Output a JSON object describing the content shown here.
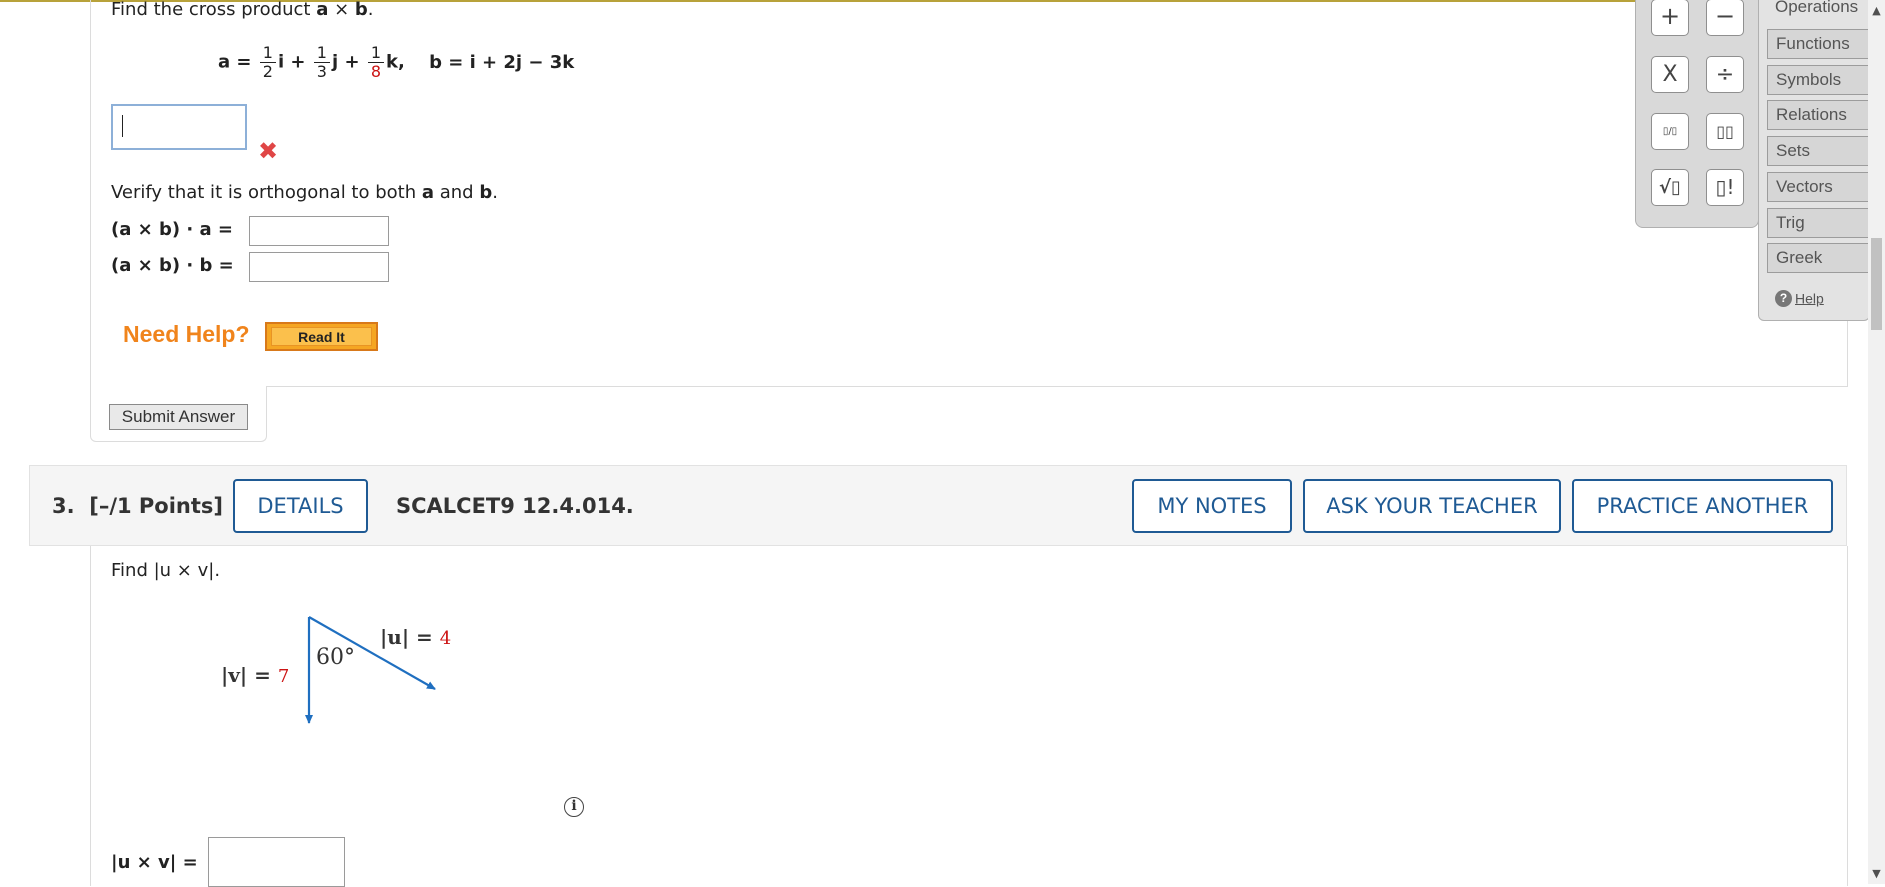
{
  "question2": {
    "prompt_pre": "Find the cross product ",
    "prompt_a": "a",
    "prompt_times": " × ",
    "prompt_b": "b",
    "prompt_end": ".",
    "vec_a_label": "a =",
    "frac_numerator": "1",
    "frac1_den": "2",
    "frac2_den": "3",
    "frac3_den": "8",
    "unit_i": "i",
    "unit_j": "j",
    "unit_k": "k,",
    "plus": "+",
    "vec_b_expr": "b = i + 2j − 3k",
    "wrong_mark": "✖",
    "verify_pre": "Verify that it is orthogonal to both ",
    "verify_a": "a",
    "verify_and": " and ",
    "verify_b": "b",
    "verify_end": ".",
    "dot_a_label": "(a × b) · a =",
    "dot_b_label": "(a × b) · b =",
    "need_help": "Need Help?",
    "read_it": "Read It",
    "submit": "Submit Answer"
  },
  "question3": {
    "number": "3.",
    "points": "[–/1 Points]",
    "details": "DETAILS",
    "code": "SCALCET9 12.4.014.",
    "my_notes": "MY NOTES",
    "ask_teacher": "ASK YOUR TEACHER",
    "practice": "PRACTICE ANOTHER",
    "prompt": "Find |u × v|.",
    "u_label": "|u| = ",
    "u_value": "4",
    "v_label": "|v| = ",
    "v_value": "7",
    "angle": "60°",
    "info_icon": "i",
    "answer_label": "|u × v| ="
  },
  "palette": {
    "buttons": {
      "plus": "+",
      "minus": "−",
      "times": "X",
      "divide": "÷",
      "fraction": "▯/▯",
      "exponent": "▯▯",
      "sqrt": "√▯",
      "factorial": "▯!"
    },
    "tabs": [
      "Operations",
      "Functions",
      "Symbols",
      "Relations",
      "Sets",
      "Vectors",
      "Trig",
      "Greek"
    ],
    "help": "Help"
  },
  "scrollbar": {
    "up_arrow": "▲",
    "down_arrow": "▼"
  },
  "colors": {
    "accent_blue": "#1f5a94",
    "need_help_orange": "#f0841c",
    "wrong_red": "#e04646",
    "value_red": "#cc1414",
    "diagram_blue": "#1f6fc0"
  }
}
